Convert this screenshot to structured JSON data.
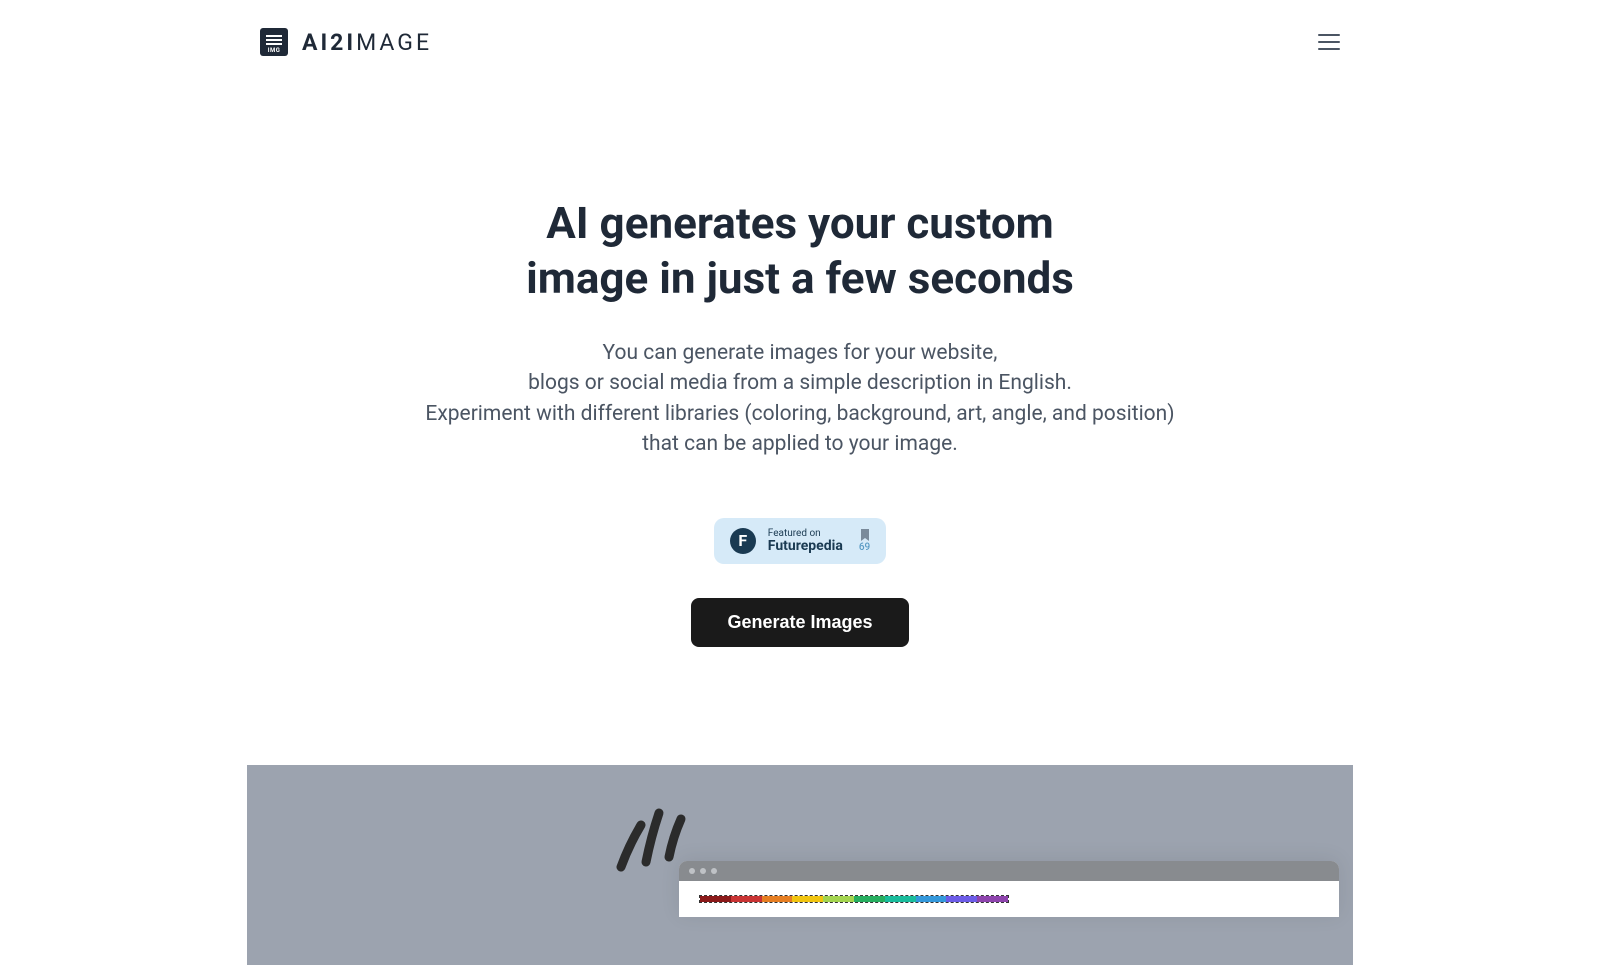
{
  "header": {
    "brand": "AI2IMAGE"
  },
  "hero": {
    "title_line1": "AI generates your custom",
    "title_line2": "image in just a few seconds",
    "subtitle_line1": "You can generate images for your website,",
    "subtitle_line2": "blogs or social media from a simple description in English.",
    "subtitle_line3": "Experiment with different libraries (coloring, background, art, angle, and position)",
    "subtitle_line4": "that can be applied to your image."
  },
  "badge": {
    "featured_label": "Featured on",
    "platform": "Futurepedia",
    "count": "69"
  },
  "cta": {
    "label": "Generate Images"
  }
}
